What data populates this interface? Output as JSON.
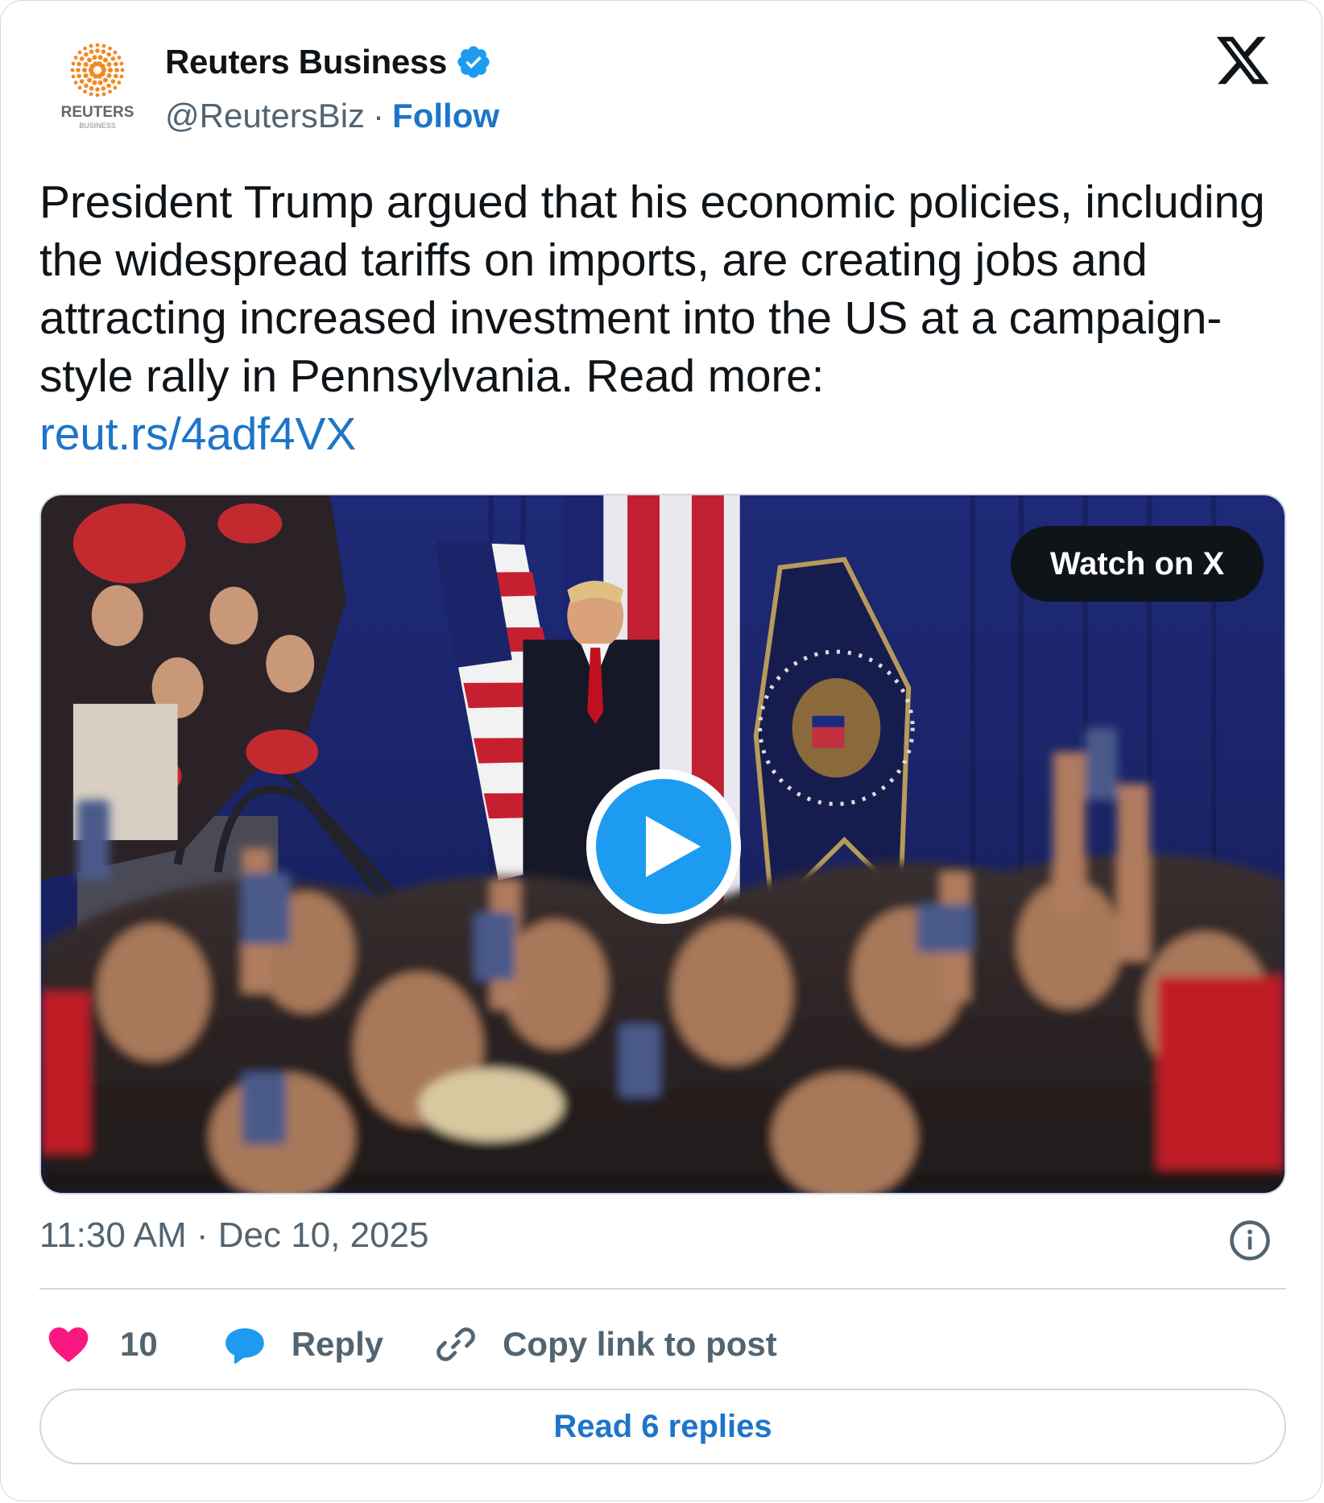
{
  "author": {
    "name": "Reuters Business",
    "handle": "@ReutersBiz",
    "separator": "·",
    "follow_label": "Follow",
    "logo_text": "REUTERS",
    "logo_subtext": "BUSINESS",
    "verified": true
  },
  "post": {
    "text": "President Trump argued that his economic policies, including the widespread tariffs on imports, are creating jobs and attracting increased investment into the US at a campaign-style rally in Pennsylvania. Read more:",
    "link": "reut.rs/4adf4VX"
  },
  "media": {
    "watch_label": "Watch on X",
    "type": "video"
  },
  "meta": {
    "timestamp": "11:30 AM · Dec 10, 2025"
  },
  "actions": {
    "like_count": "10",
    "reply_label": "Reply",
    "copy_label": "Copy link to post"
  },
  "read_replies_label": "Read 6 replies",
  "colors": {
    "accent": "#1d9bf0",
    "link": "#1d75c9",
    "like": "#f91880",
    "text": "#0f1419",
    "muted": "#536471",
    "border": "#cfd9de"
  },
  "icons": [
    "reuters-logo",
    "verified-badge-icon",
    "x-logo-icon",
    "play-icon",
    "info-icon",
    "heart-icon",
    "reply-bubble-icon",
    "link-icon"
  ]
}
